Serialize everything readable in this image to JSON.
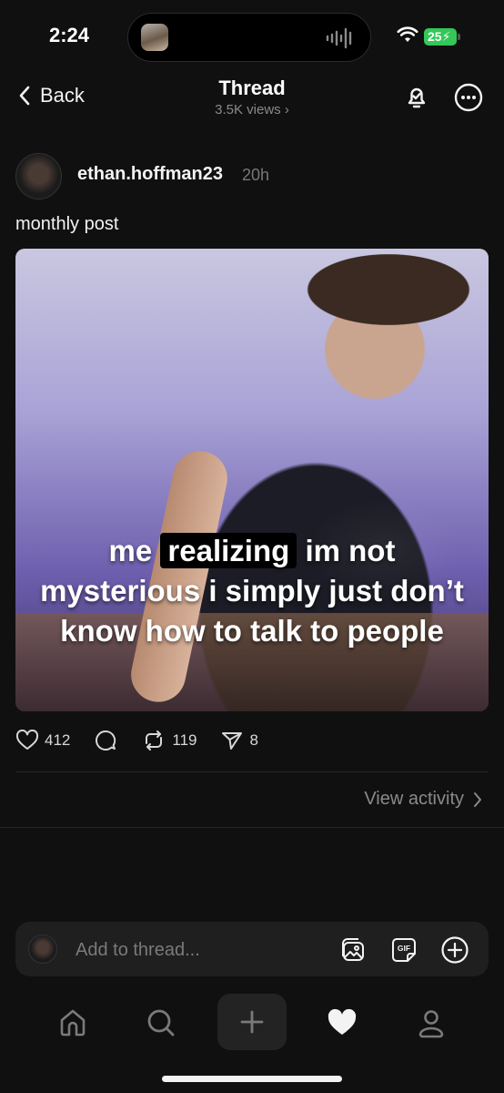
{
  "status": {
    "time": "2:24",
    "battery": "25"
  },
  "header": {
    "back_label": "Back",
    "title": "Thread",
    "views": "3.5K views"
  },
  "post": {
    "username": "ethan.hoffman23",
    "time": "20h",
    "text": "monthly post",
    "caption": {
      "line1_before": "me",
      "line1_highlight": "realizing",
      "line1_after": "im not",
      "line2": "mysterious i simply just don’t",
      "line3": "know how to talk to people"
    },
    "likes": "412",
    "reposts": "119",
    "shares": "8"
  },
  "view_activity": "View activity",
  "composer": {
    "placeholder": "Add to thread..."
  },
  "icons": {
    "back": "chevron-left-icon",
    "notify": "bell-icon",
    "more": "more-icon",
    "like": "heart-outline-icon",
    "reply": "comment-icon",
    "repost": "repost-icon",
    "share": "send-icon",
    "gallery": "gallery-icon",
    "gif": "gif-icon",
    "add": "plus-circle-icon",
    "home": "home-icon",
    "search": "search-icon",
    "create": "plus-icon",
    "activity": "heart-filled-icon",
    "profile": "profile-icon"
  },
  "colors": {
    "background": "#101010",
    "battery": "#34c759",
    "muted_text": "#8a8a8a"
  }
}
